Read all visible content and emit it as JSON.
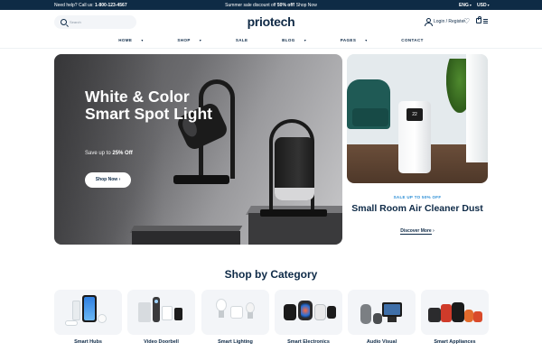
{
  "topbar": {
    "help_text": "Need help? Call us:",
    "phone": "1-800-123-4567",
    "promo_text": "Summer sale discount off",
    "promo_highlight": "50% off!",
    "promo_link": "Shop Now",
    "language": "ENG",
    "currency": "USD"
  },
  "header": {
    "search_placeholder": "Search",
    "logo": "priotech",
    "account_label": "Login / Register"
  },
  "nav": {
    "items": [
      "HOME",
      "SHOP",
      "SALE",
      "BLOG",
      "PAGES",
      "CONTACT"
    ]
  },
  "hero": {
    "title": "White & Color Smart Spot Light",
    "subtitle_prefix": "Save up to",
    "subtitle_highlight": "25% Off",
    "button": "Shop Now",
    "button_arrow": "›"
  },
  "side_promo": {
    "kicker": "SALE UP TO 50% OFF",
    "title": "Small Room Air Cleaner Dust",
    "link": "Discover More",
    "link_arrow": "›",
    "display_text": "22"
  },
  "categories": {
    "title": "Shop by Category",
    "items": [
      {
        "label": "Smart Hubs"
      },
      {
        "label": "Video Doorbell"
      },
      {
        "label": "Smart Lighting"
      },
      {
        "label": "Smart Electronics"
      },
      {
        "label": "Audio Visual"
      },
      {
        "label": "Smart Appliances"
      }
    ]
  },
  "icons": {
    "search": "search-icon",
    "user": "user-icon",
    "wishlist": "heart-icon",
    "cart": "cart-icon",
    "menu": "menu-icon"
  },
  "colors": {
    "primary": "#0e2a47",
    "accent": "#2b8ed6",
    "topbar_bg": "#0e2b45",
    "tile_bg": "#f3f5f8"
  }
}
